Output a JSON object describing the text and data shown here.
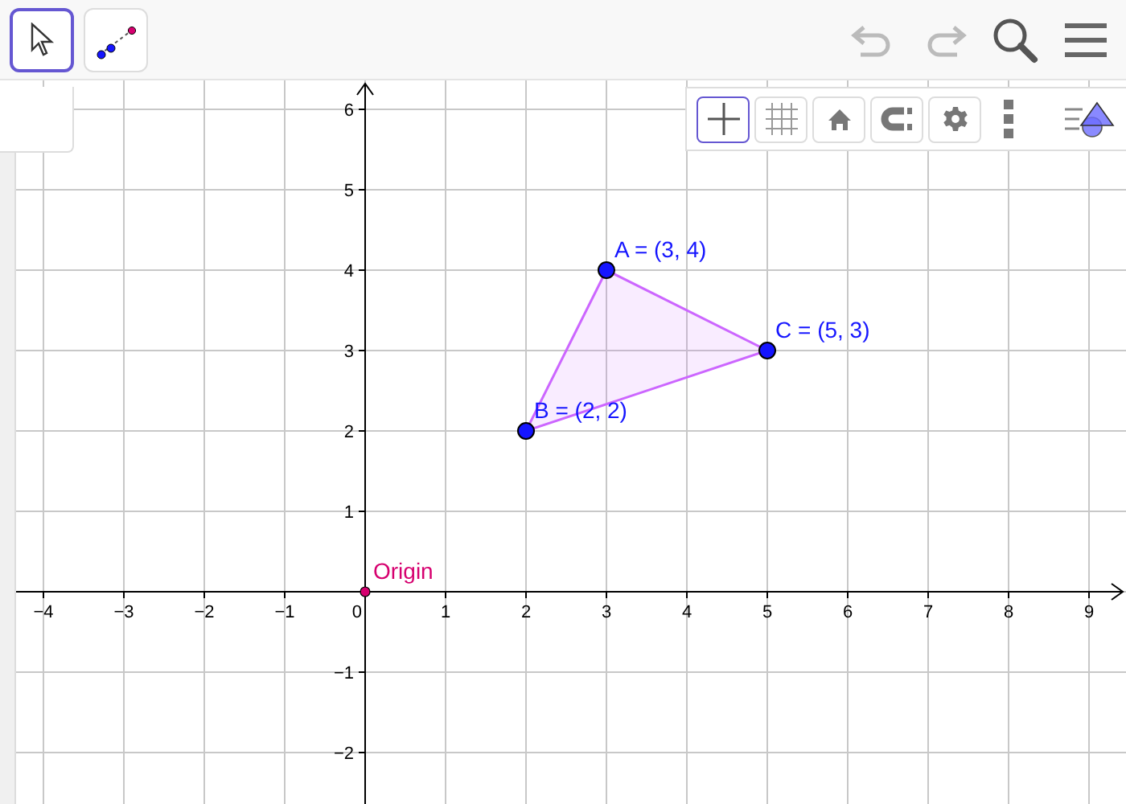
{
  "toolbar": {
    "tools": [
      {
        "kind": "move",
        "selected": true
      },
      {
        "kind": "point",
        "selected": false
      }
    ],
    "undo": {
      "disabled": true
    },
    "redo": {
      "disabled": true
    }
  },
  "style_bar": {
    "toggles": [
      {
        "kind": "axes",
        "selected": true
      },
      {
        "kind": "grid",
        "selected": false
      },
      {
        "kind": "home",
        "selected": false
      },
      {
        "kind": "magnet",
        "selected": false
      },
      {
        "kind": "settings",
        "selected": false
      }
    ]
  },
  "graphics": {
    "polygon": {
      "color": "#cc66ff"
    },
    "chart_data": {
      "type": "scatter",
      "x": [
        3,
        2,
        5,
        0
      ],
      "series": [
        {
          "name": "A = (3, 4)",
          "color": "#1515ff",
          "values": [
            4,
            null,
            null,
            null
          ]
        },
        {
          "name": "B = (2, 2)",
          "color": "#1515ff",
          "values": [
            null,
            2,
            null,
            null
          ]
        },
        {
          "name": "C = (5, 3)",
          "color": "#1515ff",
          "values": [
            null,
            null,
            3,
            null
          ]
        },
        {
          "name": "Origin",
          "color": "#d6006f",
          "values": [
            null,
            null,
            null,
            0
          ]
        }
      ],
      "grid": true,
      "xlim": [
        -4.54,
        9.46
      ],
      "ylim": [
        -2.64,
        6.36
      ],
      "xticks": [
        {
          "value": -4,
          "label": "−4"
        },
        {
          "value": -3,
          "label": "−3"
        },
        {
          "value": -2,
          "label": "−2"
        },
        {
          "value": -1,
          "label": "−1"
        },
        {
          "value": 0,
          "label": "0"
        },
        1,
        2,
        3,
        4,
        5,
        6,
        7,
        8,
        9
      ],
      "yticks": [
        {
          "value": -2,
          "label": "−2"
        },
        {
          "value": -1,
          "label": "−1"
        },
        1,
        2,
        3,
        4,
        5,
        6
      ]
    }
  }
}
